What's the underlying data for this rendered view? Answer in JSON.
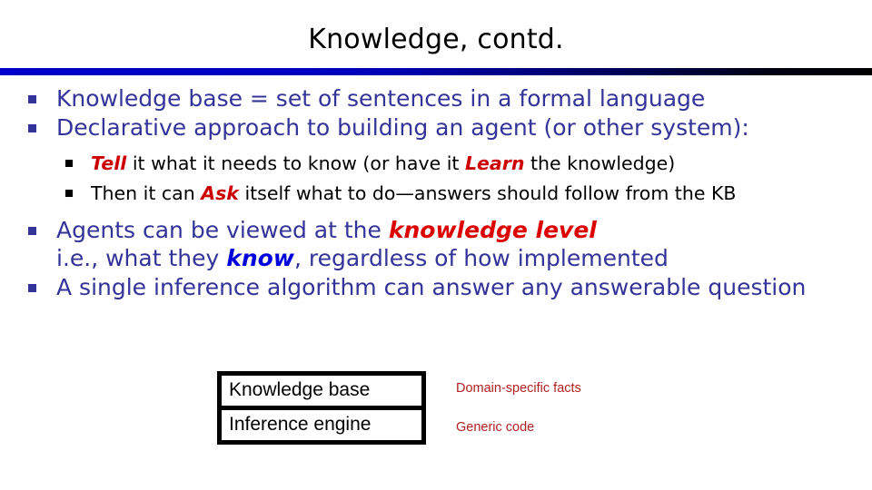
{
  "slide": {
    "title": "Knowledge, contd.",
    "accent_rule_start_color": "#0000cc",
    "accent_rule_end_color": "#000000",
    "body_text_color": "#333399",
    "emphasis_red": "#cc0000",
    "emphasis_blue": "#0000dd"
  },
  "bullets": {
    "b1": "Knowledge base = set of sentences in a formal language",
    "b2": "Declarative approach to building an agent (or other system):",
    "sub1": {
      "em1": "Tell",
      "text1": " it what it needs to know (or have it ",
      "em2": "Learn",
      "text2": " the knowledge)"
    },
    "sub2": {
      "text0": "Then it can ",
      "em1": "Ask",
      "text1": " itself what to do—answers should follow from the KB"
    },
    "b3": {
      "line1_text": "Agents can be viewed at the ",
      "line1_em": "knowledge level",
      "line2_text1": "i.e., what they ",
      "line2_em": "know",
      "line2_text2": ", regardless of how implemented"
    },
    "b4": "A single inference algorithm can answer any answerable question"
  },
  "diagram": {
    "box_knowledge_base": "Knowledge base",
    "box_inference_engine": "Inference engine",
    "label_domain_facts": "Domain-specific facts",
    "label_generic_code": "Generic code",
    "label_color": "#b02020"
  }
}
